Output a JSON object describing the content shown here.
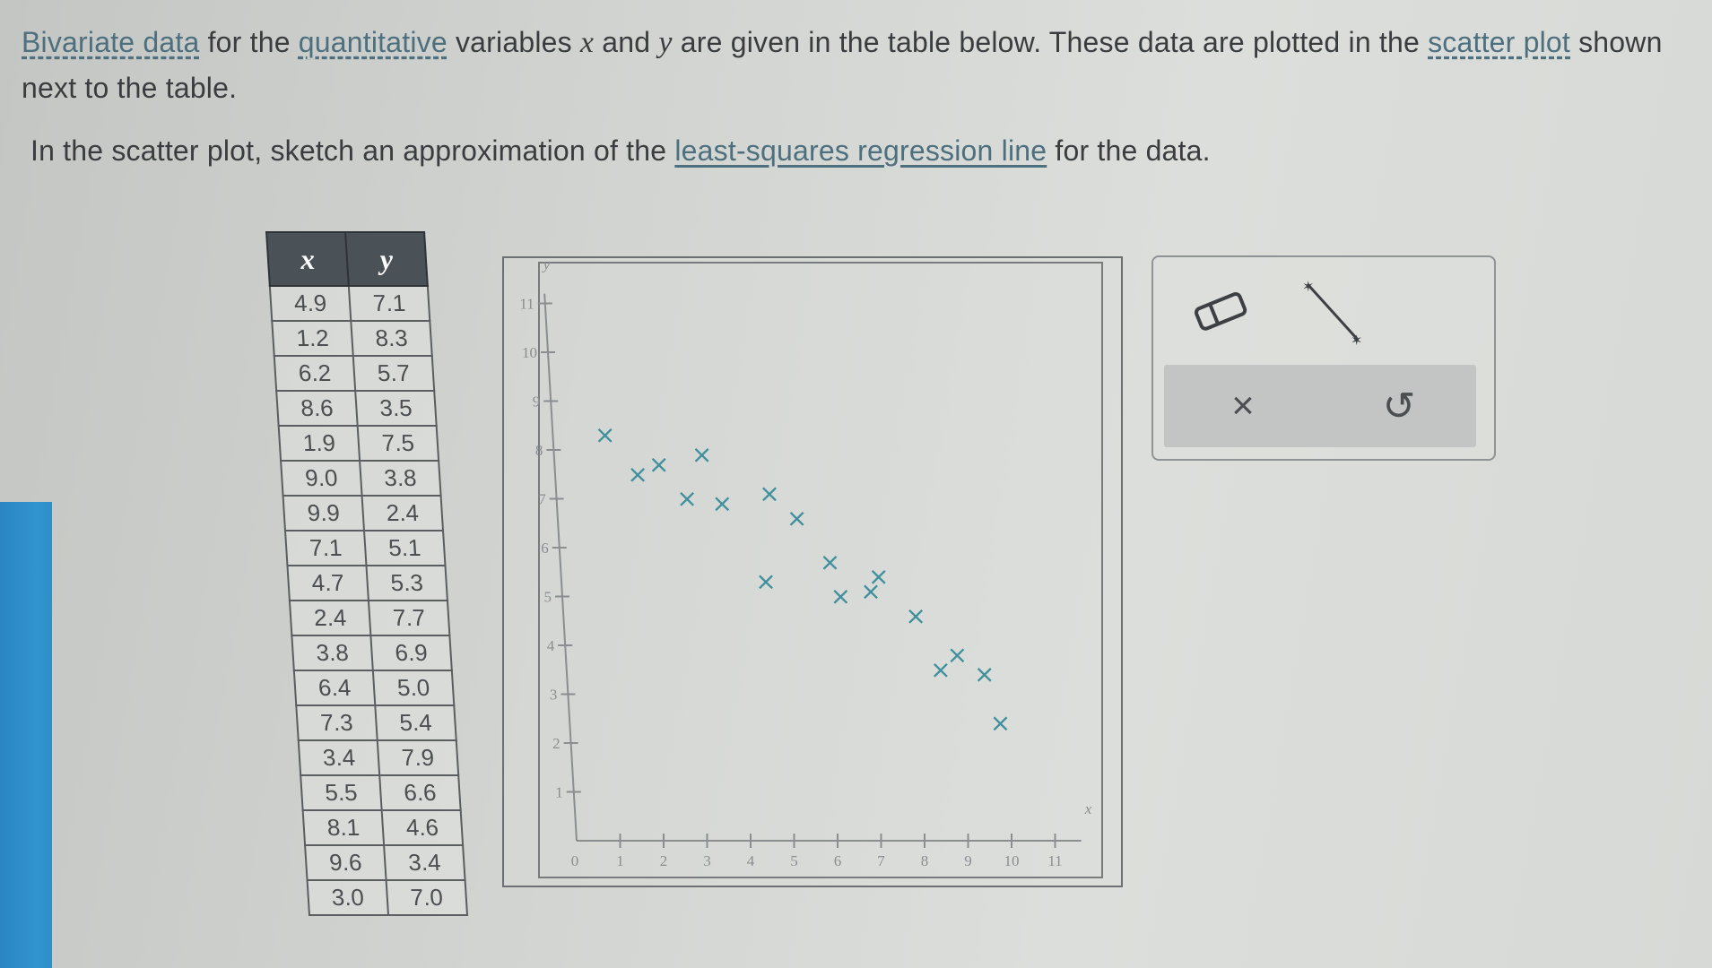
{
  "prompt": {
    "line1_glossary1": "Bivariate data",
    "line1_a": " for the ",
    "line1_glossary2": "quantitative",
    "line1_b": " variables ",
    "var_x": "x",
    "line1_c": " and ",
    "var_y": "y",
    "line1_d": " are given in the table below. These data are plotted in the ",
    "line1_glossary3": "scatter plot",
    "line1_e": " shown next to the table.",
    "line2_a": "In the scatter plot, sketch an approximation of the ",
    "line2_glossary": "least-squares regression line",
    "line2_b": " for the data."
  },
  "table": {
    "headers": [
      "x",
      "y"
    ],
    "rows": [
      [
        "4.9",
        "7.1"
      ],
      [
        "1.2",
        "8.3"
      ],
      [
        "6.2",
        "5.7"
      ],
      [
        "8.6",
        "3.5"
      ],
      [
        "1.9",
        "7.5"
      ],
      [
        "9.0",
        "3.8"
      ],
      [
        "9.9",
        "2.4"
      ],
      [
        "7.1",
        "5.1"
      ],
      [
        "4.7",
        "5.3"
      ],
      [
        "2.4",
        "7.7"
      ],
      [
        "3.8",
        "6.9"
      ],
      [
        "6.4",
        "5.0"
      ],
      [
        "7.3",
        "5.4"
      ],
      [
        "3.4",
        "7.9"
      ],
      [
        "5.5",
        "6.6"
      ],
      [
        "8.1",
        "4.6"
      ],
      [
        "9.6",
        "3.4"
      ],
      [
        "3.0",
        "7.0"
      ]
    ]
  },
  "chart_data": {
    "type": "scatter",
    "xlabel": "x",
    "ylabel": "y",
    "xlim": [
      0,
      11
    ],
    "ylim": [
      0,
      11
    ],
    "x_ticks": [
      "1",
      "2",
      "3",
      "4",
      "5",
      "6",
      "7",
      "8",
      "9",
      "10",
      "11"
    ],
    "y_ticks": [
      "1",
      "2",
      "3",
      "4",
      "5",
      "6",
      "7",
      "8",
      "9",
      "10",
      "11"
    ],
    "origin_label": "0",
    "marker": "×",
    "marker_color": "#3f8f9c",
    "points": [
      {
        "x": 4.9,
        "y": 7.1
      },
      {
        "x": 1.2,
        "y": 8.3
      },
      {
        "x": 6.2,
        "y": 5.7
      },
      {
        "x": 8.6,
        "y": 3.5
      },
      {
        "x": 1.9,
        "y": 7.5
      },
      {
        "x": 9.0,
        "y": 3.8
      },
      {
        "x": 9.9,
        "y": 2.4
      },
      {
        "x": 7.1,
        "y": 5.1
      },
      {
        "x": 4.7,
        "y": 5.3
      },
      {
        "x": 2.4,
        "y": 7.7
      },
      {
        "x": 3.8,
        "y": 6.9
      },
      {
        "x": 6.4,
        "y": 5.0
      },
      {
        "x": 7.3,
        "y": 5.4
      },
      {
        "x": 3.4,
        "y": 7.9
      },
      {
        "x": 5.5,
        "y": 6.6
      },
      {
        "x": 8.1,
        "y": 4.6
      },
      {
        "x": 9.6,
        "y": 3.4
      },
      {
        "x": 3.0,
        "y": 7.0
      }
    ]
  },
  "tools": {
    "eraser_icon": "eraser-icon",
    "line_icon": "line-tool-icon",
    "clear_label": "×",
    "undo_label": "↺"
  },
  "colors": {
    "link": "#4d6f7e",
    "marker": "#3f8f9c",
    "table_header": "#4a5157",
    "side_strip": "#2f8fc6"
  }
}
